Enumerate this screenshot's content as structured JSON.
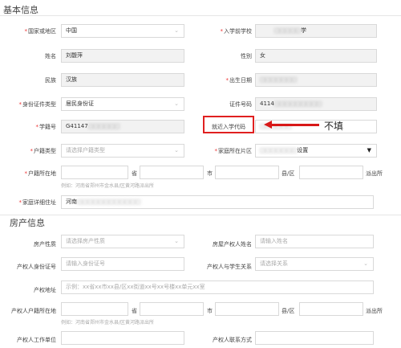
{
  "basic": {
    "title": "基本信息",
    "country_label": "国家或地区",
    "country_value": "中国",
    "school_label": "入学前学校",
    "school_value": "学",
    "name_label": "姓名",
    "name_value": "刘馥萍",
    "gender_label": "性别",
    "gender_value": "女",
    "ethnicity_label": "民族",
    "ethnicity_value": "汉族",
    "birth_label": "出生日期",
    "birth_value": "",
    "idtype_label": "身份证件类型",
    "idtype_value": "居民身份证",
    "idno_label": "证件号码",
    "idno_value": "4114",
    "studentno_label": "学籍号",
    "studentno_value": "G41147",
    "nearby_code_label": "就近入学代码",
    "hukou_type_label": "户籍类型",
    "hukou_type_placeholder": "请选择户籍类型",
    "district_label": "家庭所在片区",
    "district_value": "设置",
    "hukou_addr_label": "户籍所在地",
    "sheng_label": "省",
    "shi_label": "市",
    "xian_label": "县/区",
    "paichusuo_label": "派出所",
    "hukou_hint": "例如：河南省郑州市金水县/区黄河路派出所",
    "home_addr_label": "家庭详细住址",
    "home_addr_value": "河南"
  },
  "annotation": {
    "text": "不填"
  },
  "property": {
    "title": "房产信息",
    "nature_label": "房产性质",
    "nature_placeholder": "请选择房产性质",
    "owner_name_label": "房屋产权人姓名",
    "owner_name_placeholder": "请输入姓名",
    "owner_id_label": "产权人身份证号",
    "owner_id_placeholder": "请输入身份证号",
    "relation_label": "产权人与学生关系",
    "relation_placeholder": "请选择关系",
    "prop_addr_label": "产权地址",
    "prop_addr_placeholder": "示例：xx省xx市xx县/区xx街道xx号xx号楼xx单元xx室",
    "owner_hukou_label": "产权人户籍所在地",
    "sheng_label": "省",
    "shi_label": "市",
    "xian_label": "县/区",
    "paichusuo_label": "派出所",
    "owner_hukou_hint": "例如：河南省郑州市金水县/区黄河路派出所",
    "owner_work_label": "产权人工作单位",
    "owner_phone_label": "产权人联系方式"
  }
}
